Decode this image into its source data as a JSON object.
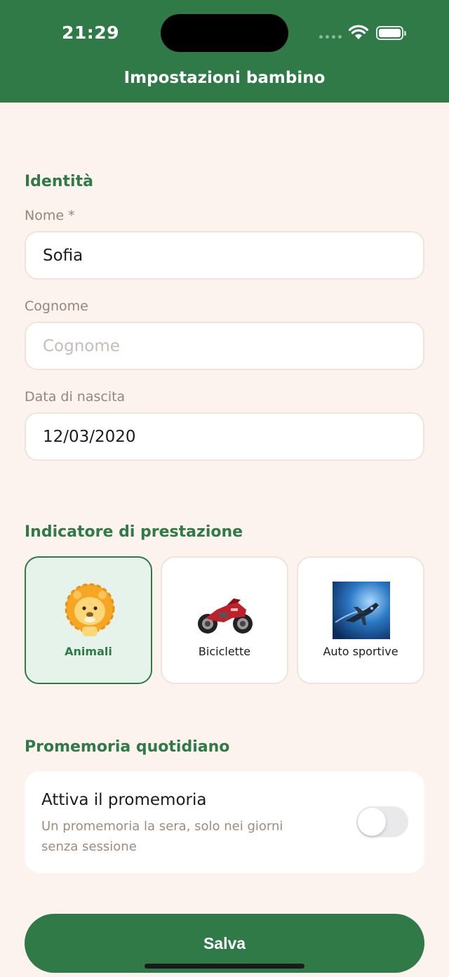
{
  "status_bar": {
    "time": "21:29"
  },
  "header": {
    "title": "Impostazioni bambino"
  },
  "identity": {
    "section_title": "Identità",
    "first_name": {
      "label": "Nome *",
      "value": "Sofia"
    },
    "last_name": {
      "label": "Cognome",
      "value": "",
      "placeholder": "Cognome"
    },
    "birth_date": {
      "label": "Data di nascita",
      "value": "12/03/2020"
    }
  },
  "indicator": {
    "section_title": "Indicatore di prestazione",
    "options": [
      {
        "label": "Animali",
        "icon": "lion-icon",
        "selected": true
      },
      {
        "label": "Biciclette",
        "icon": "motorcycle-icon",
        "selected": false
      },
      {
        "label": "Auto sportive",
        "icon": "jet-plane-icon",
        "selected": false
      }
    ]
  },
  "reminder": {
    "section_title": "Promemoria quotidiano",
    "title": "Attiva il promemoria",
    "description": "Un promemoria la sera, solo nei giorni senza sessione",
    "enabled": false
  },
  "actions": {
    "save_label": "Salva"
  },
  "colors": {
    "brand": "#2f7a47",
    "background": "#fcf3ee",
    "selected_card": "#e6f3ea"
  }
}
